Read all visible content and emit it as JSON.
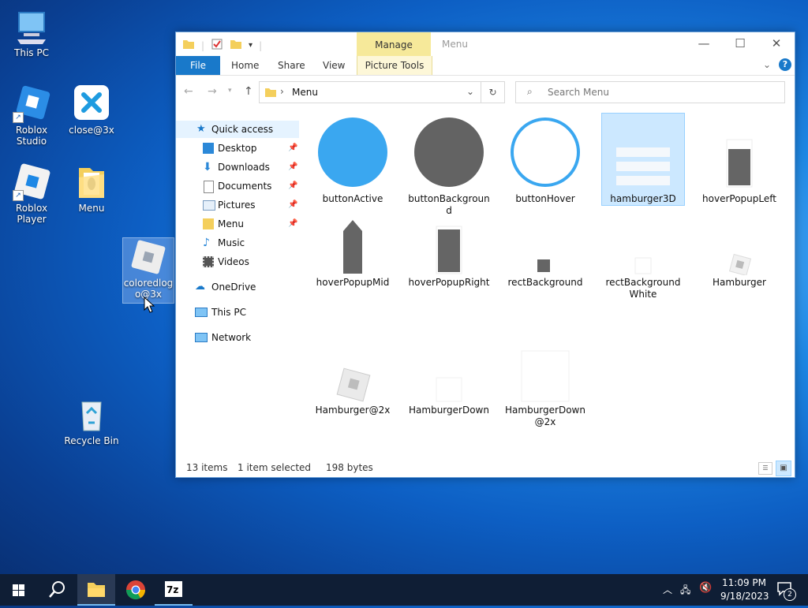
{
  "desktop": {
    "icons": [
      {
        "label": "This PC"
      },
      {
        "label": "Roblox Studio"
      },
      {
        "label": "close@3x"
      },
      {
        "label": "Roblox Player"
      },
      {
        "label": "Menu"
      },
      {
        "label": "coloredlogo@3x"
      },
      {
        "label": "Recycle Bin"
      }
    ]
  },
  "window": {
    "title": "Menu",
    "manage_label": "Manage",
    "picture_tools_label": "Picture Tools",
    "ribbon_tabs": {
      "file": "File",
      "home": "Home",
      "share": "Share",
      "view": "View"
    },
    "address": "Menu",
    "search_placeholder": "Search Menu",
    "nav": {
      "quick_access": "Quick access",
      "desktop": "Desktop",
      "downloads": "Downloads",
      "documents": "Documents",
      "pictures": "Pictures",
      "menu": "Menu",
      "music": "Music",
      "videos": "Videos",
      "onedrive": "OneDrive",
      "this_pc": "This PC",
      "network": "Network"
    },
    "files": [
      {
        "name": "buttonActive"
      },
      {
        "name": "buttonBackground"
      },
      {
        "name": "buttonHover"
      },
      {
        "name": "hamburger3D"
      },
      {
        "name": "hoverPopupLeft"
      },
      {
        "name": "hoverPopupMid"
      },
      {
        "name": "hoverPopupRight"
      },
      {
        "name": "rectBackground"
      },
      {
        "name": "rectBackgroundWhite"
      },
      {
        "name": "Hamburger"
      },
      {
        "name": "Hamburger@2x"
      },
      {
        "name": "HamburgerDown"
      },
      {
        "name": "HamburgerDown@2x"
      }
    ],
    "status": {
      "items": "13 items",
      "selected": "1 item selected",
      "size": "198 bytes"
    }
  },
  "taskbar": {
    "time": "11:09 PM",
    "date": "9/18/2023",
    "notification_count": "2"
  },
  "colors": {
    "accent": "#1979ca",
    "selection": "#cce8ff",
    "taskbar": "#0f1e35"
  }
}
